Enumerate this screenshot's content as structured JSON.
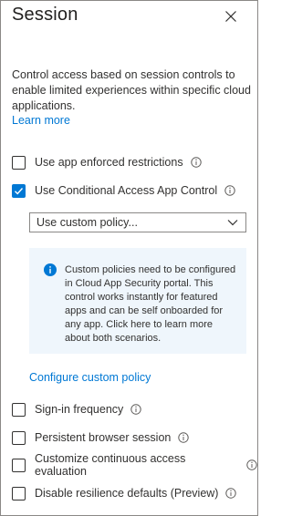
{
  "panel": {
    "title": "Session",
    "description": "Control access based on session controls to enable limited experiences within specific cloud applications.",
    "learn_more": "Learn more"
  },
  "options": [
    {
      "label": "Use app enforced restrictions",
      "checked": false
    },
    {
      "label": "Use Conditional Access App Control",
      "checked": true
    }
  ],
  "policy_select": {
    "value": "Use custom policy..."
  },
  "notice": {
    "text": "Custom policies need to be configured in Cloud App Security portal. This control works instantly for featured apps and can be self onboarded for any app. Click here to learn more about both scenarios."
  },
  "configure_link": "Configure custom policy",
  "more_options": [
    {
      "label": "Sign-in frequency",
      "checked": false
    },
    {
      "label": "Persistent browser session",
      "checked": false
    },
    {
      "label": "Customize continuous access evaluation",
      "checked": false
    },
    {
      "label": "Disable resilience defaults (Preview)",
      "checked": false
    }
  ],
  "colors": {
    "accent": "#0078d4",
    "notice_bg": "#eff6fc",
    "border": "#8a8886"
  },
  "icons": [
    "close-icon",
    "info-icon",
    "checkmark-icon",
    "chevron-down-icon",
    "info-filled-icon"
  ]
}
